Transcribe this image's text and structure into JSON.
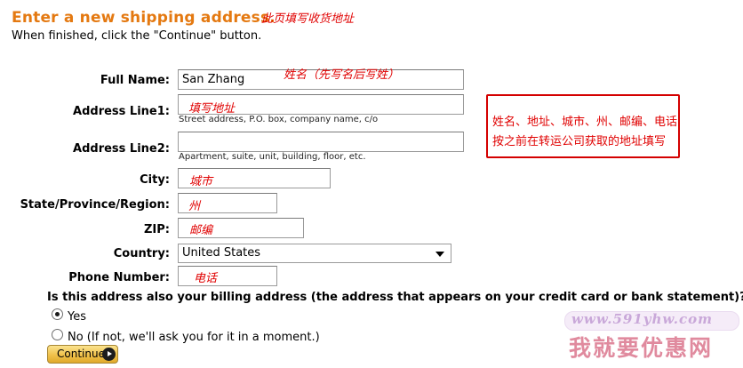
{
  "header": {
    "title": "Enter a new shipping address.",
    "title_annotation": "此页填写收货地址",
    "subtitle": "When finished, click the \"Continue\" button."
  },
  "form": {
    "full_name": {
      "label": "Full Name:",
      "value": "San Zhang",
      "annotation": "姓名（先写名后写姓）"
    },
    "address_line1": {
      "label": "Address Line1:",
      "value": "",
      "annotation": "填写地址",
      "hint": "Street address, P.O. box, company name, c/o"
    },
    "address_line2": {
      "label": "Address Line2:",
      "value": "",
      "hint": "Apartment, suite, unit, building, floor, etc."
    },
    "city": {
      "label": "City:",
      "value": "",
      "annotation": "城市"
    },
    "state": {
      "label": "State/Province/Region:",
      "value": "",
      "annotation": "州"
    },
    "zip": {
      "label": "ZIP:",
      "value": "",
      "annotation": "邮编"
    },
    "country": {
      "label": "Country:",
      "value": "United States"
    },
    "phone": {
      "label": "Phone Number:",
      "value": "",
      "annotation": "电话"
    }
  },
  "side_note": {
    "line1": "姓名、地址、城市、州、邮编、电话",
    "line2": "按之前在转运公司获取的地址填写"
  },
  "billing": {
    "question": "Is this address also your billing address (the address that appears on your credit card or bank statement)?",
    "yes_label": "Yes",
    "no_label": "No  (If not, we'll ask you for it in a moment.)",
    "selected": "yes"
  },
  "continue_button": {
    "label": "Continue"
  },
  "watermark": {
    "url": "www.591yhw.com",
    "name": "我就要优惠网"
  },
  "colors": {
    "title": "#E47911",
    "annotation": "#e00000",
    "button": "#f0c14b"
  }
}
